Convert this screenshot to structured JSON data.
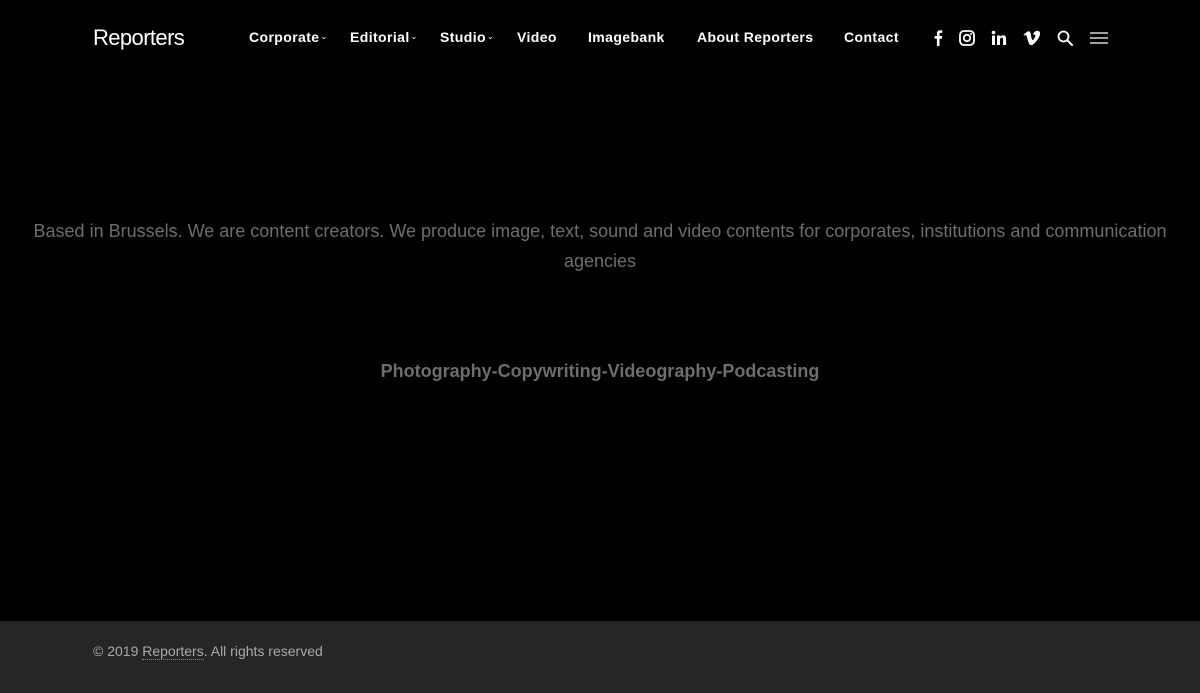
{
  "header": {
    "logo": "Reporters",
    "nav": [
      {
        "label": "Corporate",
        "dropdown": true
      },
      {
        "label": "Editorial",
        "dropdown": true
      },
      {
        "label": "Studio",
        "dropdown": true
      },
      {
        "label": "Video",
        "dropdown": false
      },
      {
        "label": "Imagebank",
        "dropdown": false
      },
      {
        "label": "About Reporters",
        "dropdown": false
      },
      {
        "label": "Contact",
        "dropdown": false
      }
    ],
    "caret": "⌄",
    "icons": [
      "facebook-icon",
      "instagram-icon",
      "linkedin-icon",
      "vimeo-icon",
      "search-icon",
      "hamburger-menu-icon"
    ]
  },
  "main": {
    "intro": "Based in Brussels. We are content creators. We produce image, text, sound and video contents for corporates, institutions and communication agencies",
    "services": "Photography-Copywriting-Videography-Podcasting"
  },
  "footer": {
    "copyright_prefix": "© 2019 ",
    "brand_link": "Reporters",
    "copyright_suffix": ". All rights reserved"
  },
  "colors": {
    "background": "#000000",
    "footer_background": "#262626",
    "text_muted": "#6d6d6d",
    "nav_text": "#ffffff"
  }
}
